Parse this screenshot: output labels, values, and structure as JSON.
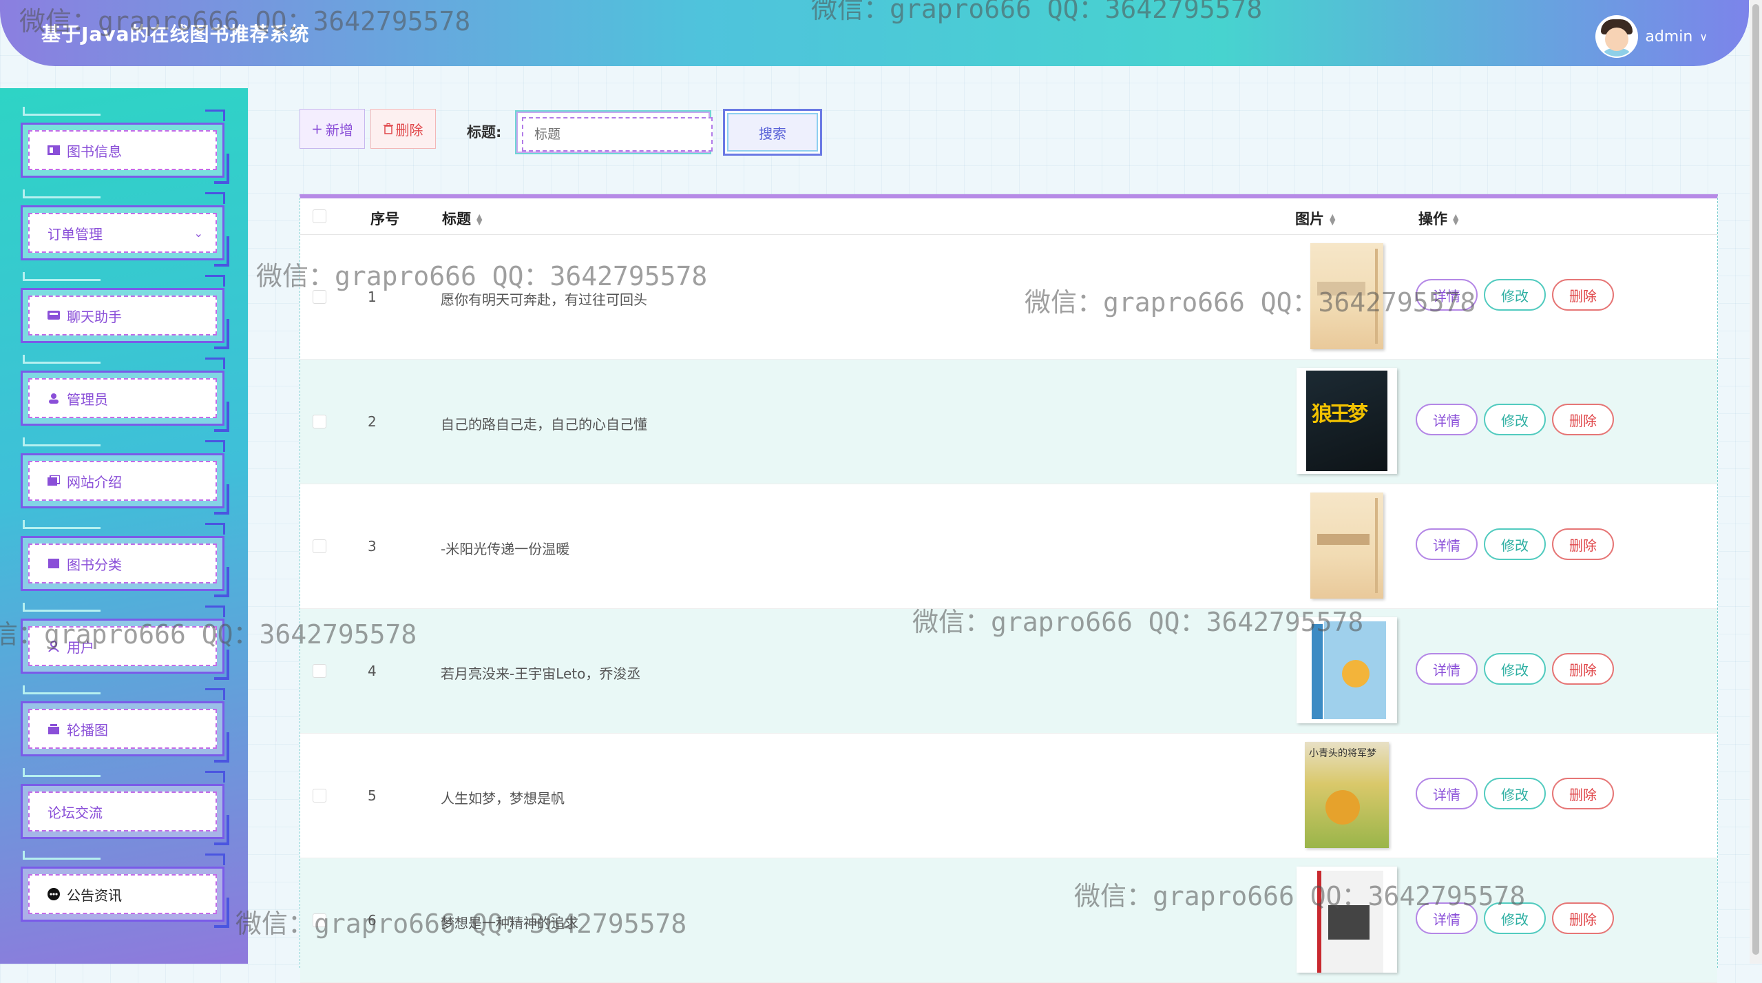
{
  "header": {
    "title": "基于Java的在线图书推荐系统",
    "username": "admin",
    "user_caret": "∨"
  },
  "sidebar": {
    "items": [
      {
        "label": "图书信息",
        "icon": "book-icon"
      },
      {
        "label": "订单管理",
        "icon": "",
        "expandable": true
      },
      {
        "label": "聊天助手",
        "icon": "chat-icon"
      },
      {
        "label": "管理员",
        "icon": "user-icon"
      },
      {
        "label": "网站介绍",
        "icon": "intro-icon"
      },
      {
        "label": "图书分类",
        "icon": "category-icon"
      },
      {
        "label": "用户",
        "icon": "user-outline-icon"
      },
      {
        "label": "轮播图",
        "icon": "carousel-icon"
      },
      {
        "label": "论坛交流",
        "icon": ""
      },
      {
        "label": "公告资讯",
        "icon": "announcement-icon",
        "active": true
      }
    ]
  },
  "toolbar": {
    "add_label": "新增",
    "delete_label": "删除",
    "search_label": "标题:",
    "search_placeholder": "标题",
    "search_button": "搜索"
  },
  "table": {
    "headers": {
      "index": "序号",
      "title": "标题",
      "image": "图片",
      "actions": "操作"
    },
    "actions": {
      "detail": "详情",
      "edit": "修改",
      "delete": "删除"
    },
    "rows": [
      {
        "index": "1",
        "title": "愿你有明天可奔赴，有过往可回头"
      },
      {
        "index": "2",
        "title": "自己的路自己走，自己的心自己懂"
      },
      {
        "index": "3",
        "title": "-米阳光传递一份温暖"
      },
      {
        "index": "4",
        "title": "若月亮没来-王宇宙Leto，乔浚丞"
      },
      {
        "index": "5",
        "title": "人生如梦，梦想是帆"
      },
      {
        "index": "6",
        "title": "梦想是一种精神的追求"
      }
    ]
  },
  "book_covers": {
    "row2_title": "狼王梦",
    "row5_title": "小青头的将军梦"
  },
  "watermark": "微信：grapro666 QQ：3642795578"
}
